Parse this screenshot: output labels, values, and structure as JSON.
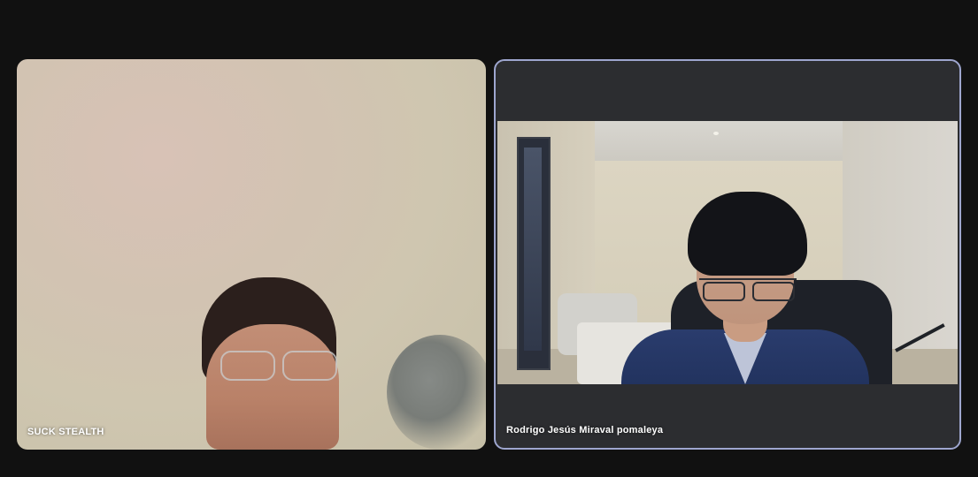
{
  "participants": [
    {
      "name": "SUCK STEALTH",
      "active_speaker": false
    },
    {
      "name": "Rodrigo Jesús Miraval pomaleya",
      "active_speaker": true
    }
  ],
  "colors": {
    "background": "#111111",
    "active_speaker_border": "#9ea6cf",
    "label_text": "#ffffff"
  }
}
